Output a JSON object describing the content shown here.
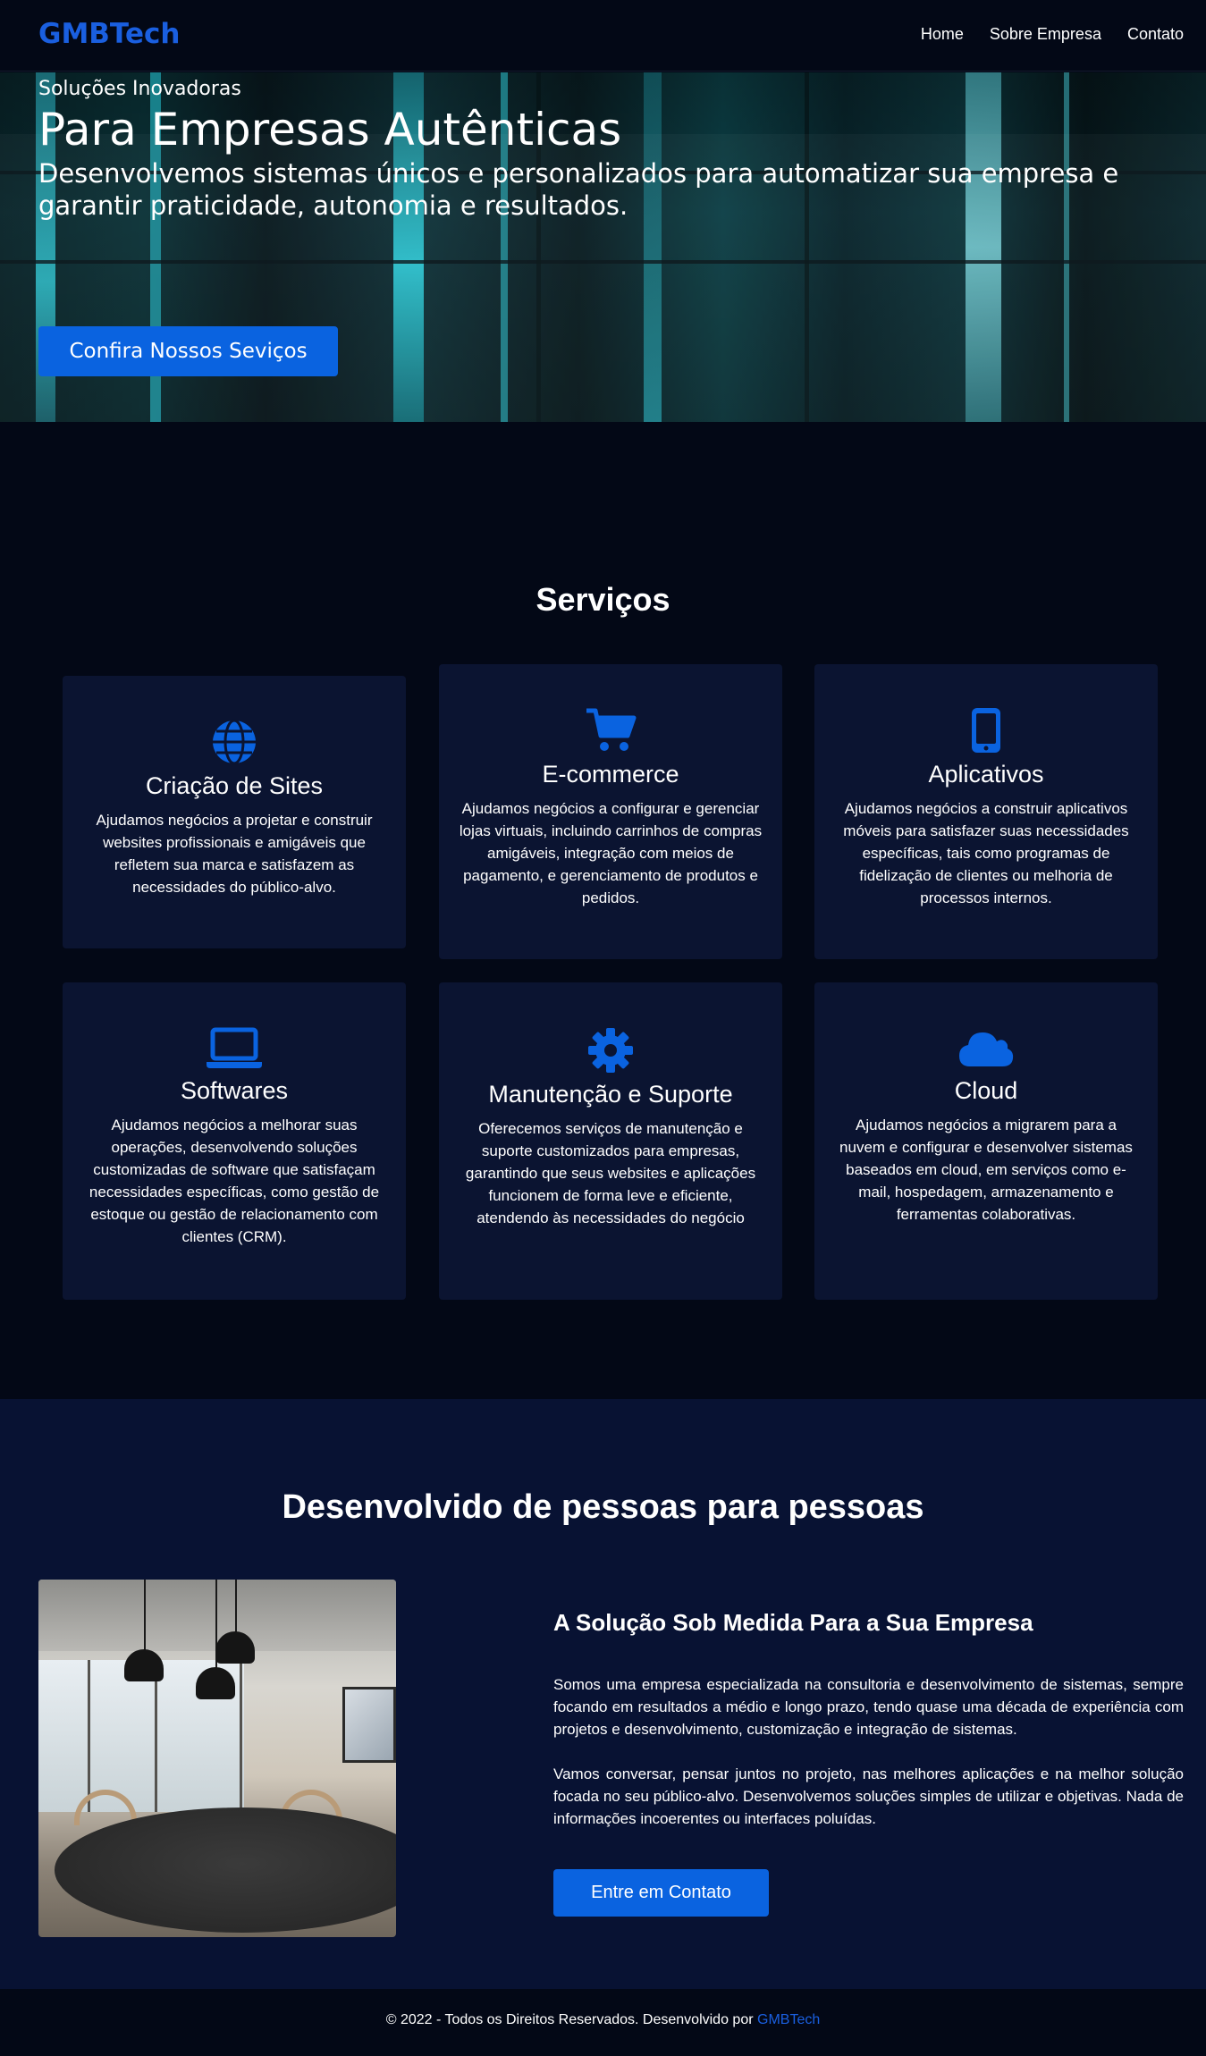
{
  "nav": {
    "logo": "GMBTech",
    "items": [
      "Home",
      "Sobre Empresa",
      "Contato"
    ]
  },
  "hero": {
    "kicker": "Soluções Inovadoras",
    "title": "Para Empresas Autênticas",
    "subtitle": "Desenvolvemos sistemas únicos e personalizados para automatizar sua empresa e garantir praticidade, autonomia e resultados.",
    "cta": "Confira Nossos Seviços"
  },
  "services": {
    "title": "Serviços",
    "items": [
      {
        "icon": "globe-icon",
        "title": "Criação de Sites",
        "text": "Ajudamos negócios a projetar e construir websites profissionais e amigáveis que refletem sua marca e satisfazem as necessidades do público-alvo."
      },
      {
        "icon": "cart-icon",
        "title": "E-commerce",
        "text": "Ajudamos negócios a configurar e gerenciar lojas virtuais, incluindo carrinhos de compras amigáveis, integração com meios de pagamento, e gerenciamento de produtos e pedidos."
      },
      {
        "icon": "mobile-icon",
        "title": "Aplicativos",
        "text": "Ajudamos negócios a construir aplicativos móveis para satisfazer suas necessidades específicas, tais como programas de fidelização de clientes ou melhoria de processos internos."
      },
      {
        "icon": "laptop-icon",
        "title": "Softwares",
        "text": "Ajudamos negócios a melhorar suas operações, desenvolvendo soluções customizadas de software que satisfaçam necessidades específicas, como gestão de estoque ou gestão de relacionamento com clientes (CRM)."
      },
      {
        "icon": "gear-icon",
        "title": "Manutenção e Suporte",
        "text": "Oferecemos serviços de manutenção e suporte customizados para empresas, garantindo que seus websites e aplicações funcionem de forma leve e eficiente, atendendo às necessidades do negócio"
      },
      {
        "icon": "cloud-icon",
        "title": "Cloud",
        "text": "Ajudamos negócios a migrarem para a nuvem e configurar e desenvolver sistemas baseados em cloud, em serviços como e-mail, hospedagem, armazenamento e ferramentas colaborativas."
      }
    ]
  },
  "about": {
    "title": "Desenvolvido de pessoas para pessoas",
    "subtitle": "A Solução Sob Medida Para a Sua Empresa",
    "p1": "Somos uma empresa especializada na consultoria e desenvolvimento de sistemas, sempre focando em resultados a médio e longo prazo, tendo quase uma década de experiência com projetos e desenvolvimento, customização e integração de sistemas.",
    "p2": "Vamos conversar, pensar juntos no projeto, nas melhores aplicações e na melhor solução focada no seu público-alvo. Desenvolvemos soluções simples de utilizar e objetivas. Nada de informações incoerentes ou interfaces poluídas.",
    "cta": "Entre em Contato"
  },
  "footer": {
    "text": "© 2022 - Todos os Direitos Reservados. Desenvolvido por ",
    "brand": "GMBTech"
  },
  "colors": {
    "background": "#030816",
    "card": "#0b1431",
    "about_bg": "#081233",
    "accent": "#0a63e0",
    "brand": "#1a5fe0"
  }
}
